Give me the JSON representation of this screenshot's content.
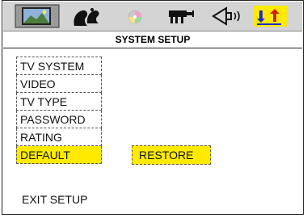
{
  "header": {
    "title": "SYSTEM SETUP",
    "icons": [
      {
        "name": "general-setup-icon",
        "selected": true
      },
      {
        "name": "speaker-setup-icon",
        "selected": false
      },
      {
        "name": "audio-disc-icon",
        "selected": false
      },
      {
        "name": "video-camera-icon",
        "selected": false
      },
      {
        "name": "speaker-volume-icon",
        "selected": false
      },
      {
        "name": "preference-arrows-icon",
        "selected": false
      }
    ]
  },
  "menu": {
    "items": [
      {
        "label": "TV SYSTEM",
        "selected": false
      },
      {
        "label": "VIDEO",
        "selected": false
      },
      {
        "label": "TV TYPE",
        "selected": false
      },
      {
        "label": "PASSWORD",
        "selected": false
      },
      {
        "label": "RATING",
        "selected": false
      },
      {
        "label": "DEFAULT",
        "selected": true
      }
    ]
  },
  "submenu": {
    "option": "RESTORE"
  },
  "footer": {
    "exit_label": "EXIT SETUP"
  },
  "colors": {
    "highlight": "#ffea00",
    "iconbar": "#d4d4d4"
  }
}
